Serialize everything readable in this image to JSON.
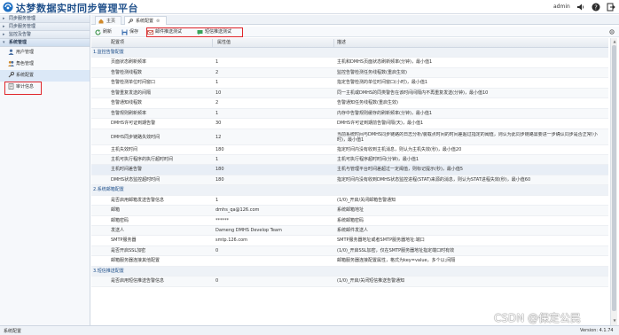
{
  "header": {
    "app_title": "达梦数据实时同步管理平台",
    "user": "admin",
    "icons": [
      "logo-icon",
      "sound-icon",
      "help-icon",
      "logout-icon"
    ]
  },
  "sidebar": {
    "groups": [
      {
        "label": "同步服务管理",
        "expanded": false
      },
      {
        "label": "同步服务管理",
        "expanded": false
      },
      {
        "label": "监控及告警",
        "expanded": false
      },
      {
        "label": "系统管理",
        "expanded": true
      }
    ],
    "items": [
      {
        "label": "用户管理",
        "icon": "user-icon"
      },
      {
        "label": "角色管理",
        "icon": "role-icon"
      },
      {
        "label": "系统配置",
        "icon": "config-icon",
        "selected": true
      },
      {
        "label": "审计信息",
        "icon": "audit-icon"
      }
    ]
  },
  "tabs": [
    {
      "label": "主页",
      "icon": "home-icon"
    },
    {
      "label": "系统配置",
      "icon": "config-icon",
      "active": true
    }
  ],
  "toolbar": {
    "refresh_label": "刷新",
    "save_label": "保存",
    "mail_test_label": "邮件推送测试",
    "sms_test_label": "短信推送测试"
  },
  "table": {
    "columns": [
      "配置项",
      "属性值",
      "描述"
    ],
    "groups": [
      {
        "title": "1.监控告警配置",
        "rows": [
          {
            "name": "页面状态刷新频率",
            "value": "1",
            "desc": "主机和DMHS页面状态刷新频率(分钟)，最小值1"
          },
          {
            "name": "告警检测线程数",
            "value": "2",
            "desc": "监控告警检测任务线程数(重启生效)"
          },
          {
            "name": "告警检测单位时间窗口",
            "value": "1",
            "desc": "指定告警检测的单位时间窗口(小时)，最小值1"
          },
          {
            "name": "告警重复发送的间隔",
            "value": "10",
            "desc": "同一主机或DMHS的同类警告在该时间间隔内不再重复发送(分钟)，最小值10"
          },
          {
            "name": "告警通知线程数",
            "value": "2",
            "desc": "告警通知任务线程数(重启生效)"
          },
          {
            "name": "告警规则刷新频率",
            "value": "1",
            "desc": "内存中告警规则缓存的刷新频率(分钟)，最小值1"
          },
          {
            "name": "DMHS许可证到期告警",
            "value": "30",
            "desc": "DMHS许可证到期前告警间隔(天)，最小值1"
          },
          {
            "name": "DMHS同步链路失效时间",
            "value": "12",
            "desc": "当前系统时间与DMHS同步链路的日志分析/装载点时间的时间差超过指定的阈值，则认为此同步链路需要进一步确认同步是否正常(小时)，最小值1",
            "tall": true
          },
          {
            "name": "主机失效时间",
            "value": "180",
            "desc": "指定时间内没有收到主机消息，则认为主机失效(秒)，最小值20"
          },
          {
            "name": "主机可执行程序的执行超时时间",
            "value": "1",
            "desc": "主机可执行程序超时时间(分钟)，最小值1"
          },
          {
            "name": "主机时间差告警",
            "value": "180",
            "desc": "主机与管理平台时间差超过一定阈值，则标记提示(秒)，最小值5",
            "highlight": true
          },
          {
            "name": "DMHS状态监控超时时间",
            "value": "180",
            "desc": "指定时间内没有收到DMHS状态监控进程(STAT)来源的消息，则认为STAT进程失效(秒)，最小值60"
          }
        ]
      },
      {
        "title": "2.系统邮箱配置",
        "rows": [
          {
            "name": "是否启用邮箱发送告警信息",
            "value": "1",
            "desc": "(1/0)_开启/关闭邮箱告警通知"
          },
          {
            "name": "邮箱",
            "value": "dmhs_qa@126.com",
            "desc": "系统邮箱地址"
          },
          {
            "name": "邮箱密码",
            "value": "******",
            "desc": "系统邮箱密码"
          },
          {
            "name": "发送人",
            "value": "Dameng DMHS Develop Team",
            "desc": "系统邮件发送人"
          },
          {
            "name": "SMTP服务器",
            "value": "smtp.126.com",
            "desc": "SMTP服务器地址或者SMTP服务器地址:端口"
          },
          {
            "name": "是否开启SSL加密",
            "value": "0",
            "desc": "(1/0)_开启SSL加密，仅在SMTP服务器地址指定端口时有效"
          },
          {
            "name": "邮箱服务器连接其他配置",
            "value": "",
            "desc": "邮箱服务器连接配置属性，格式为key=value，多个以;间隔"
          }
        ]
      },
      {
        "title": "3.短信推送配置",
        "rows": [
          {
            "name": "是否启用短信推送告警信息",
            "value": "0",
            "desc": "(1/0)_开启/关闭短信推送告警通知"
          }
        ]
      }
    ]
  },
  "status": {
    "left": "系统配置",
    "version": "Version: 4.1.74"
  },
  "watermark": "CSDN @保定公民",
  "colors": {
    "accent": "#1e4f8a",
    "highlight_box": "#e0262b",
    "selected_bg": "#dbe8f7"
  }
}
